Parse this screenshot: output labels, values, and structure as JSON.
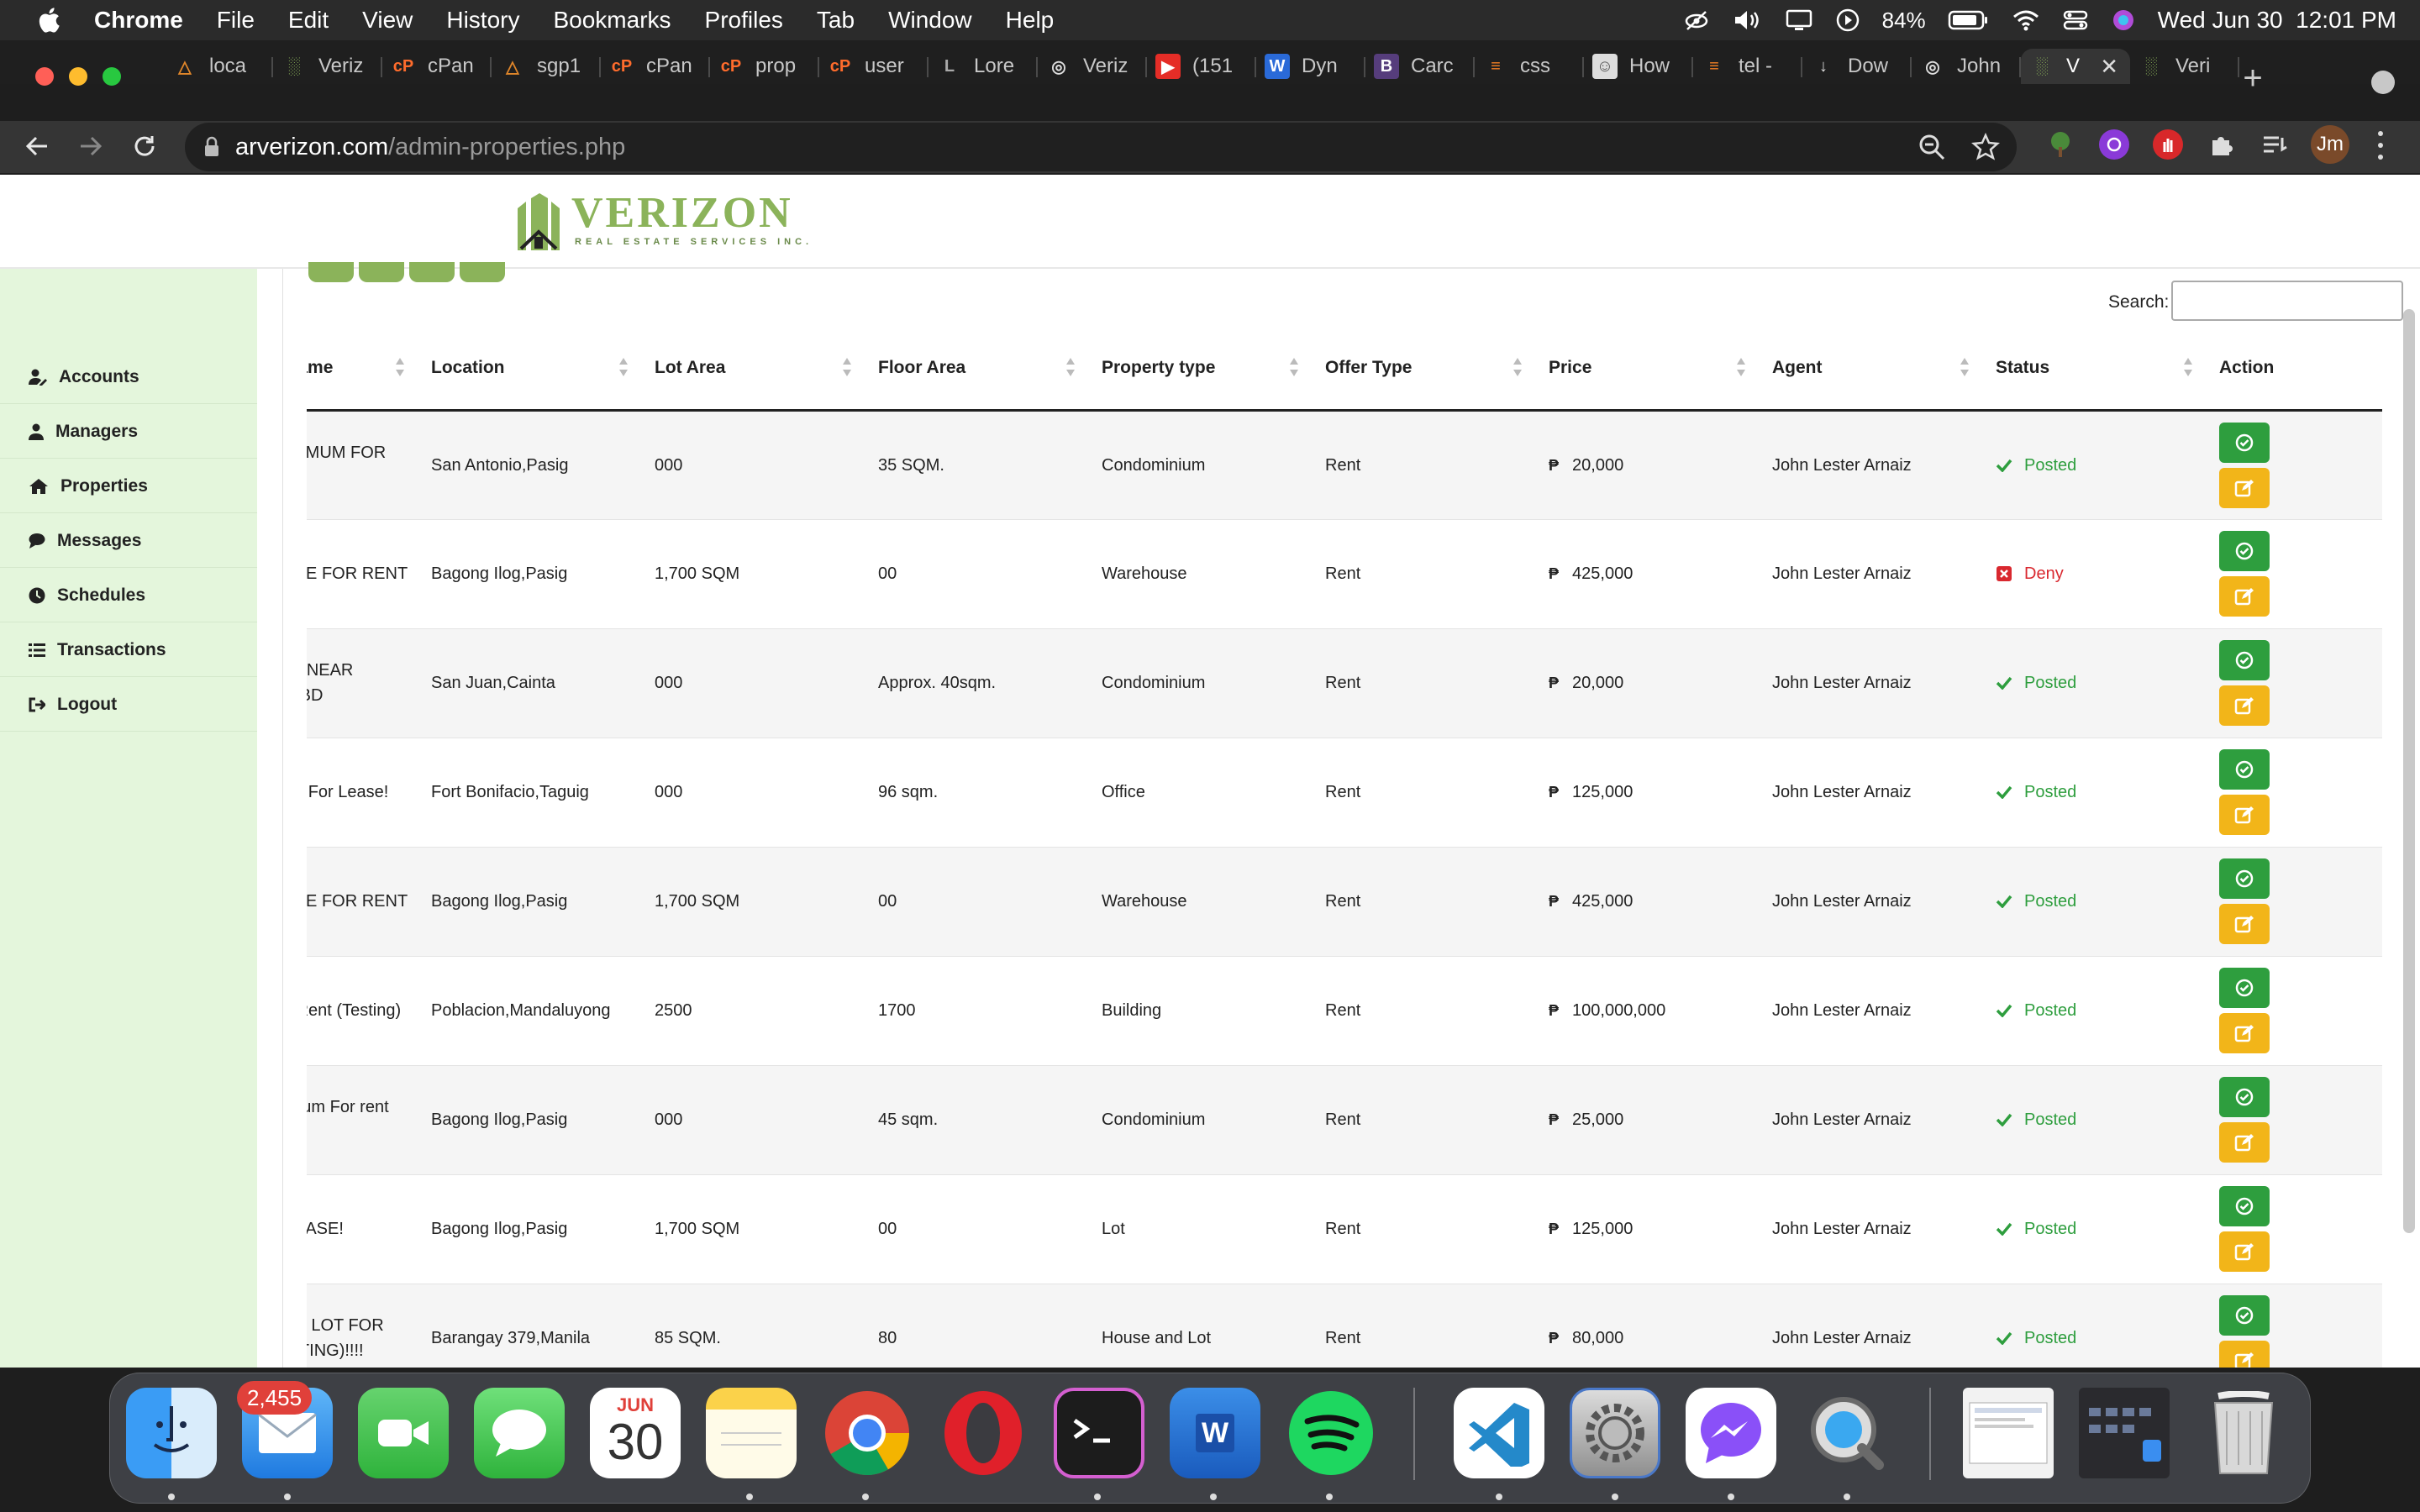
{
  "menubar": {
    "app": "Chrome",
    "items": [
      "File",
      "Edit",
      "View",
      "History",
      "Bookmarks",
      "Profiles",
      "Tab",
      "Window",
      "Help"
    ],
    "battery": "84%",
    "datetime": "Wed Jun 30  12:01 PM"
  },
  "tabs": [
    {
      "label": "loca",
      "icon": "tent-icon"
    },
    {
      "label": "Veriz",
      "icon": "verizon-icon"
    },
    {
      "label": "cPan",
      "icon": "cpanel-icon"
    },
    {
      "label": "sgp1",
      "icon": "tent-icon"
    },
    {
      "label": "cPan",
      "icon": "cpanel-icon"
    },
    {
      "label": "prop",
      "icon": "cpanel-icon"
    },
    {
      "label": "user",
      "icon": "cpanel-icon"
    },
    {
      "label": "Lore",
      "icon": "lorem-icon"
    },
    {
      "label": "Veriz",
      "icon": "globe-icon"
    },
    {
      "label": "(151",
      "icon": "youtube-icon"
    },
    {
      "label": "Dyn",
      "icon": "w-icon"
    },
    {
      "label": "Carc",
      "icon": "bootstrap-icon"
    },
    {
      "label": "css",
      "icon": "stackoverflow-icon"
    },
    {
      "label": "How",
      "icon": "avatar-icon"
    },
    {
      "label": "tel -",
      "icon": "stackoverflow-icon"
    },
    {
      "label": "Dow",
      "icon": "download-icon"
    },
    {
      "label": "John",
      "icon": "globe-icon"
    },
    {
      "label": "V",
      "icon": "verizon-icon",
      "active": true
    },
    {
      "label": "Veri",
      "icon": "verizon-icon"
    }
  ],
  "omnibox": {
    "host": "arverizon.com",
    "path": "/admin-properties.php"
  },
  "profile": {
    "initials": "Jm"
  },
  "logo": {
    "word": "VERIZON",
    "tagline": "REAL ESTATE SERVICES INC."
  },
  "sidebar": {
    "items": [
      {
        "label": "Accounts",
        "icon": "user-edit-icon"
      },
      {
        "label": "Managers",
        "icon": "users-icon"
      },
      {
        "label": "Properties",
        "icon": "home-icon"
      },
      {
        "label": "Messages",
        "icon": "chat-icon"
      },
      {
        "label": "Schedules",
        "icon": "clock-icon"
      },
      {
        "label": "Transactions",
        "icon": "list-icon"
      },
      {
        "label": "Logout",
        "icon": "logout-icon"
      }
    ]
  },
  "search": {
    "label": "Search:",
    "value": ""
  },
  "table": {
    "columns": [
      "Property Name",
      "Location",
      "Lot Area",
      "Floor Area",
      "Property type",
      "Offer Type",
      "Price",
      "Agent",
      "Status",
      "Action"
    ],
    "rows": [
      {
        "name": "CONDOMINIMUM FOR RENT",
        "location": "San Antonio,Pasig",
        "lot": "000",
        "floor": "35 SQM.",
        "type": "Condominium",
        "offer": "Rent",
        "currency": "₱",
        "price": "20,000",
        "agent": "John Lester Arnaiz",
        "status": "Posted"
      },
      {
        "name": "WAREHOUSE FOR RENT",
        "location": "Bagong Ilog,Pasig",
        "lot": "1,700 SQM",
        "floor": "00",
        "type": "Warehouse",
        "offer": "Rent",
        "currency": "₱",
        "price": "425,000",
        "agent": "John Lester Arnaiz",
        "status": "Deny"
      },
      {
        "name": "FOR LEASE NEAR ORTIGAS CBD",
        "location": "San Juan,Cainta",
        "lot": "000",
        "floor": "Approx. 40sqm.",
        "type": "Condominium",
        "offer": "Rent",
        "currency": "₱",
        "price": "20,000",
        "agent": "John Lester Arnaiz",
        "status": "Posted"
      },
      {
        "name": "Office Space For Lease!",
        "location": "Fort Bonifacio,Taguig",
        "lot": "000",
        "floor": "96 sqm.",
        "type": "Office",
        "offer": "Rent",
        "currency": "₱",
        "price": "125,000",
        "agent": "John Lester Arnaiz",
        "status": "Posted"
      },
      {
        "name": "WAREHOUSE FOR RENT",
        "location": "Bagong Ilog,Pasig",
        "lot": "1,700 SQM",
        "floor": "00",
        "type": "Warehouse",
        "offer": "Rent",
        "currency": "₱",
        "price": "425,000",
        "agent": "John Lester Arnaiz",
        "status": "Posted"
      },
      {
        "name": "Building for Rent (Testing)",
        "location": "Poblacion,Mandaluyong",
        "lot": "2500",
        "floor": "1700",
        "type": "Building",
        "offer": "Rent",
        "currency": "₱",
        "price": "100,000,000",
        "agent": "John Lester Arnaiz",
        "status": "Posted"
      },
      {
        "name": "Condominimum For rent Testing",
        "location": "Bagong Ilog,Pasig",
        "lot": "000",
        "floor": "45 sqm.",
        "type": "Condominium",
        "offer": "Rent",
        "currency": "₱",
        "price": "25,000",
        "agent": "John Lester Arnaiz",
        "status": "Posted"
      },
      {
        "name": "LOT FOR LEASE!",
        "location": "Bagong Ilog,Pasig",
        "lot": "1,700 SQM",
        "floor": "00",
        "type": "Lot",
        "offer": "Rent",
        "currency": "₱",
        "price": "125,000",
        "agent": "John Lester Arnaiz",
        "status": "Posted"
      },
      {
        "name": "HOUSE AND LOT FOR LEASE (tESTING)!!!!",
        "location": "Barangay 379,Manila",
        "lot": "85 SQM.",
        "floor": "80",
        "type": "House and Lot",
        "offer": "Rent",
        "currency": "₱",
        "price": "80,000",
        "agent": "John Lester Arnaiz",
        "status": "Posted"
      }
    ]
  },
  "dock": {
    "mail_badge": "2,455",
    "calendar_month": "JUN",
    "calendar_day": "30",
    "apps": [
      "finder-icon",
      "mail-icon",
      "facetime-icon",
      "messages-icon",
      "calendar-icon",
      "notes-icon",
      "chrome-icon",
      "opera-icon",
      "terminal-icon",
      "word-icon",
      "spotify-icon",
      "vscode-icon",
      "system-preferences-icon",
      "messenger-icon",
      "quicktime-icon",
      "downloads-stack-icon",
      "screenshots-stack-icon",
      "trash-icon"
    ]
  },
  "colors": {
    "brand_green": "#8bb35a",
    "sidebar_bg": "#e4f6dc",
    "posted_green": "#2e9e3e",
    "deny_red": "#d9282f",
    "edit_yellow": "#f2b519"
  }
}
